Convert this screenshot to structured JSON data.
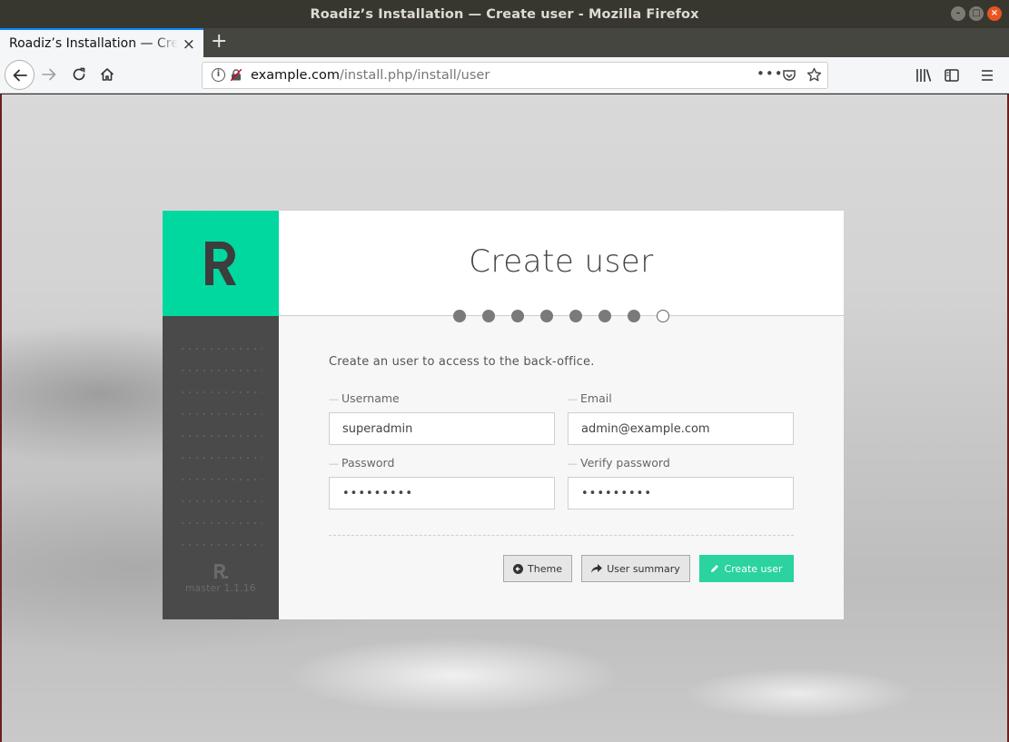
{
  "window": {
    "title": "Roadiz’s Installation — Create user - Mozilla Firefox",
    "controls": [
      "–",
      "□",
      "×"
    ]
  },
  "tabs": [
    {
      "title": "Roadiz’s Installation — Create user",
      "close": "×"
    }
  ],
  "new_tab_label": "+",
  "navbar": {
    "url_host": "example.com",
    "url_path": "/install.php/install/user",
    "icons": [
      "back-icon",
      "forward-icon",
      "reload-icon",
      "home-icon",
      "info-icon",
      "insecure-lock-icon",
      "page-actions-icon",
      "pocket-icon",
      "bookmark-star-icon",
      "library-icon",
      "sidebar-icon",
      "menu-icon"
    ],
    "page_actions_label": "•••"
  },
  "page": {
    "logo": "R",
    "title": "Create user",
    "steps": {
      "total": 8,
      "current": 8
    },
    "intro": "Create an user to access to the back-office.",
    "fields": {
      "username": {
        "label": "Username",
        "value": "superadmin"
      },
      "email": {
        "label": "Email",
        "value": "admin@example.com"
      },
      "password": {
        "label": "Password",
        "value": "•••••••••"
      },
      "verify_password": {
        "label": "Verify password",
        "value": "•••••••••"
      }
    },
    "buttons": {
      "theme": "Theme",
      "user_summary": "User summary",
      "create_user": "Create user"
    },
    "footer": {
      "logo": "R.",
      "version": "master 1.1.16"
    }
  },
  "colors": {
    "brand_green": "#00d8a0",
    "button_green": "#2ad3a0",
    "sidebar": "#4a4a4a"
  }
}
